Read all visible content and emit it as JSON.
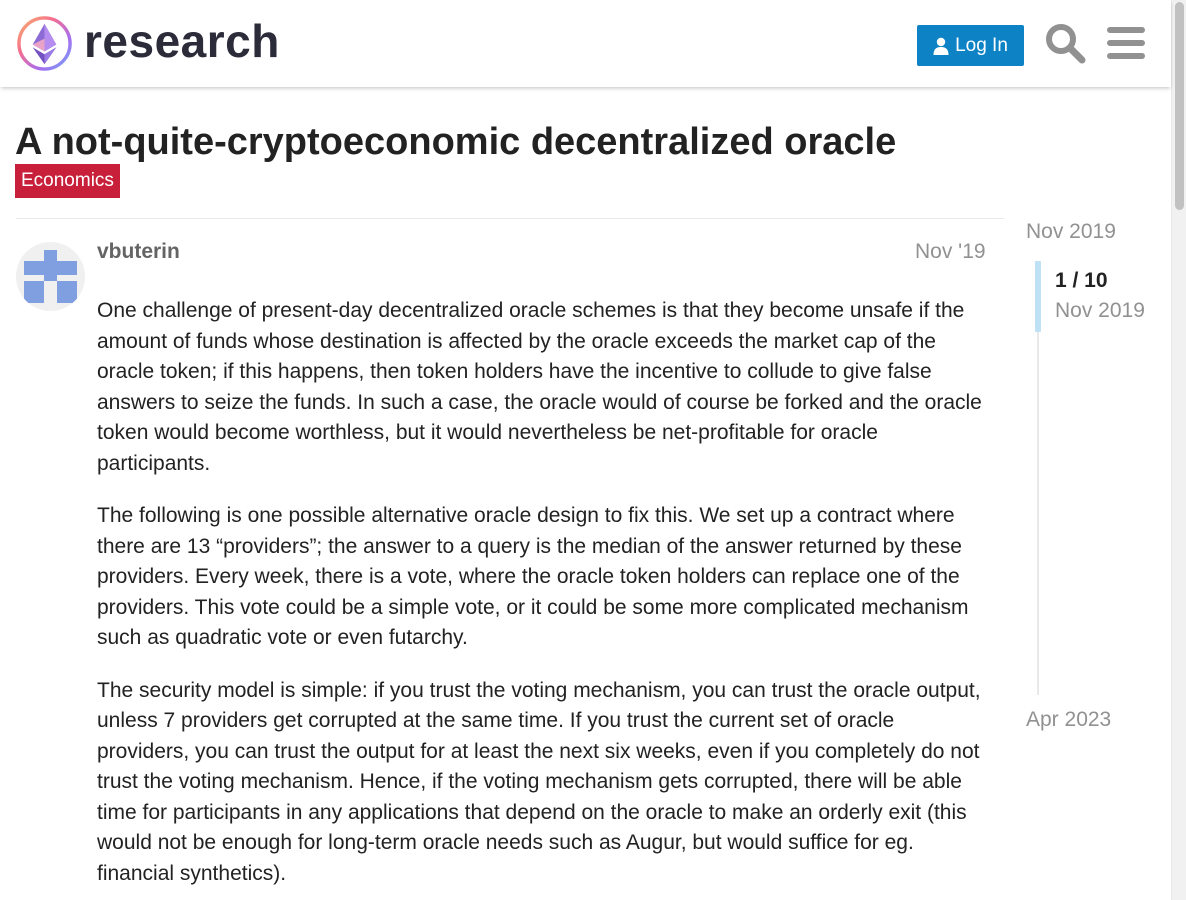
{
  "header": {
    "site_name": "research",
    "login_label": "Log In"
  },
  "topic": {
    "title": "A not-quite-cryptoeconomic decentralized oracle",
    "category": "Economics",
    "category_color": "#c8203a"
  },
  "post": {
    "username": "vbuterin",
    "date": "Nov '19",
    "paragraphs": [
      "One challenge of present-day decentralized oracle schemes is that they become unsafe if the amount of funds whose destination is affected by the oracle exceeds the market cap of the oracle token; if this happens, then token holders have the incentive to collude to give false answers to seize the funds. In such a case, the oracle would of course be forked and the oracle token would become worthless, but it would nevertheless be net-profitable for oracle participants.",
      "The following is one possible alternative oracle design to fix this. We set up a contract where there are 13 “providers”; the answer to a query is the median of the answer returned by these providers. Every week, there is a vote, where the oracle token holders can replace one of the providers. This vote could be a simple vote, or it could be some more complicated mechanism such as quadratic vote or even futarchy.",
      "The security model is simple: if you trust the voting mechanism, you can trust the oracle output, unless 7 providers get corrupted at the same time. If you trust the current set of oracle providers, you can trust the output for at least the next six weeks, even if you completely do not trust the voting mechanism. Hence, if the voting mechanism gets corrupted, there will be able time for participants in any applications that depend on the oracle to make an orderly exit (this would not be enough for long-term oracle needs such as Augur, but would suffice for eg. financial synthetics)."
    ]
  },
  "timeline": {
    "start_date": "Nov 2019",
    "position": "1 / 10",
    "position_date": "Nov 2019",
    "end_date": "Apr 2023"
  },
  "colors": {
    "accent": "#0d83c6",
    "timeline_handle": "#bfe1f6",
    "avatar": "#7f9fe0"
  }
}
